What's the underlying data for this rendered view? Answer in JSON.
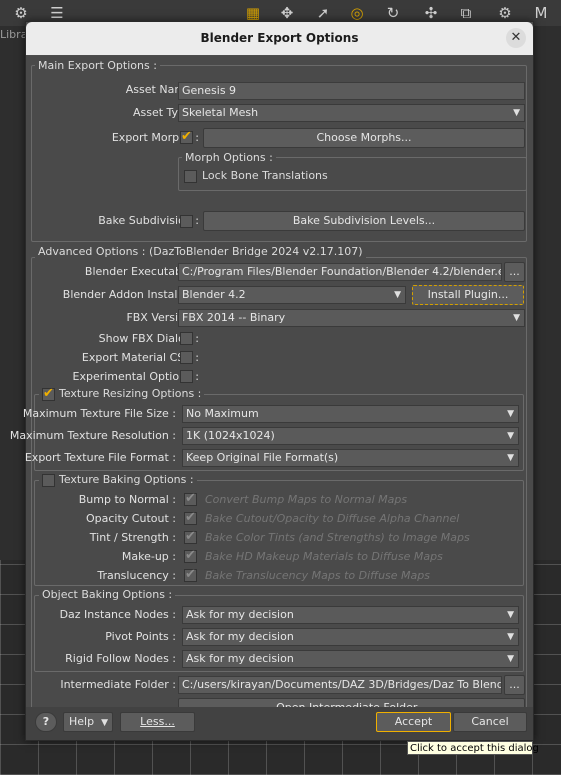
{
  "background": {
    "library_tab": "Libra",
    "tooltip": "Click to accept this dialog"
  },
  "dialog": {
    "title": "Blender Export Options",
    "close_glyph": "✕",
    "main_group": {
      "title": "Main Export Options :",
      "asset_name_label": "Asset Name :",
      "asset_name_value": "Genesis 9",
      "asset_type_label": "Asset Type :",
      "asset_type_value": "Skeletal Mesh",
      "export_morphs_label": "Export Morphs :",
      "export_morphs_checked": true,
      "choose_morphs_button": "Choose Morphs...",
      "morph_options_title": "Morph Options :",
      "lock_bone_translations_label": "Lock Bone Translations",
      "lock_bone_translations_checked": false,
      "bake_subdivision_label": "Bake Subdivision :",
      "bake_subdivision_checked": false,
      "bake_subdivision_levels_button": "Bake Subdivision Levels..."
    },
    "advanced_group": {
      "title": "Advanced Options : (DazToBlender Bridge 2024 v2.17.107)",
      "blender_executable_label": "Blender Executable :",
      "blender_executable_value": "C:/Program Files/Blender Foundation/Blender 4.2/blender.exe",
      "browse_button": "...",
      "addon_installer_label": "Blender Addon Installer :",
      "addon_installer_value": "Blender 4.2",
      "install_plugin_button": "Install Plugin...",
      "fbx_version_label": "FBX Version :",
      "fbx_version_value": "FBX 2014 -- Binary",
      "show_fbx_dialog_label": "Show FBX Dialog :",
      "export_material_csv_label": "Export Material CSV :",
      "experimental_options_label": "Experimental Options :",
      "texture_resizing": {
        "title": "Texture Resizing Options :",
        "checked": true,
        "max_file_size_label": "Maximum Texture File Size :",
        "max_file_size_value": "No Maximum",
        "max_resolution_label": "Maximum Texture Resolution :",
        "max_resolution_value": "1K (1024x1024)",
        "export_format_label": "Export Texture File Format :",
        "export_format_value": "Keep Original File Format(s)"
      },
      "texture_baking": {
        "title": "Texture Baking Options :",
        "checked": false,
        "rows": [
          {
            "label": "Bump to Normal :",
            "text": "Convert Bump Maps to Normal Maps"
          },
          {
            "label": "Opacity Cutout :",
            "text": "Bake Cutout/Opacity to Diffuse Alpha Channel"
          },
          {
            "label": "Tint / Strength :",
            "text": "Bake Color Tints (and Strengths) to Image Maps"
          },
          {
            "label": "Make-up :",
            "text": "Bake HD Makeup Materials to Diffuse Maps"
          },
          {
            "label": "Translucency :",
            "text": "Bake Translucency Maps to Diffuse Maps"
          }
        ]
      },
      "object_baking": {
        "title": "Object Baking Options :",
        "instance_label": "Daz Instance Nodes :",
        "instance_value": "Ask for my decision",
        "pivot_label": "Pivot Points :",
        "pivot_value": "Ask for my decision",
        "rigid_label": "Rigid Follow Nodes :",
        "rigid_value": "Ask for my decision"
      },
      "intermediate_folder_label": "Intermediate Folder :",
      "intermediate_folder_value": "C:/users/kirayan/Documents/DAZ 3D/Bridges/Daz To Blender/",
      "open_intermediate_button": "Open Intermediate Folder..."
    },
    "footer": {
      "help_icon": "?",
      "help_button": "Help",
      "less_button": "Less...",
      "accept_button": "Accept",
      "cancel_button": "Cancel"
    }
  },
  "colors": {
    "accent": "#f0b000",
    "title_bar": "#ececec",
    "dialog_bg": "#4a4a4a"
  }
}
